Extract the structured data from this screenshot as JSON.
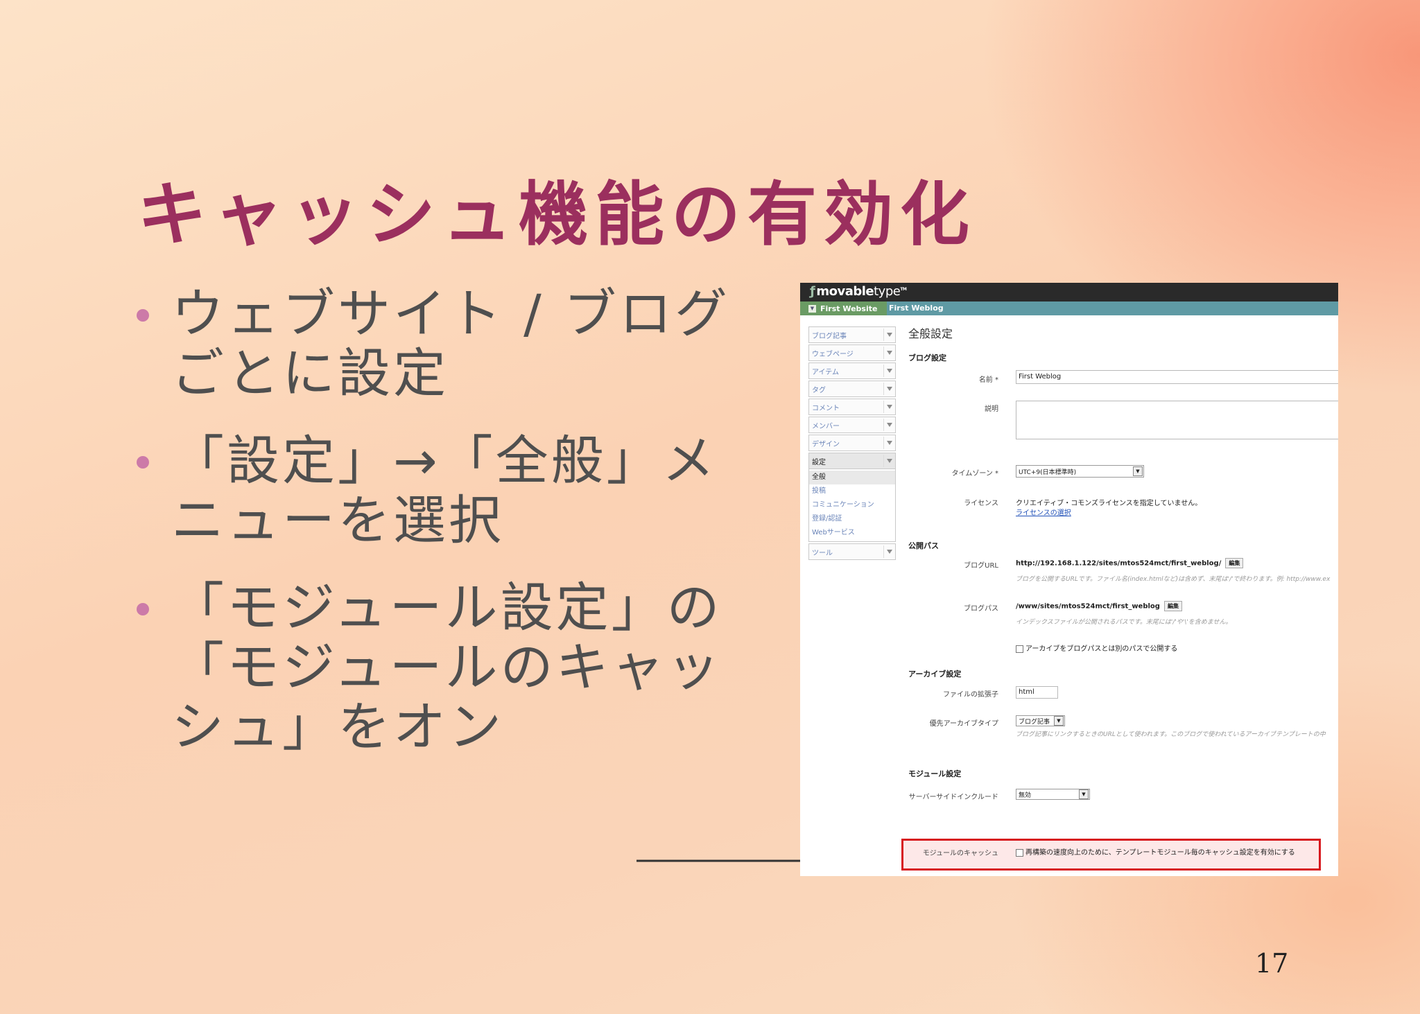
{
  "slide": {
    "title": "キャッシュ機能の有効化",
    "bullets": [
      "ウェブサイト / ブログごとに設定",
      "「設定」→「全般」メニューを選択",
      "「モジュール設定」の「モジュールのキャッシュ」をオン"
    ],
    "page_number": "17"
  },
  "screenshot": {
    "logo": {
      "bold": "movable",
      "light": "type",
      "tm": "TM"
    },
    "breadcrumb": {
      "website": "First Website",
      "blog": "First Weblog"
    },
    "sidebar": [
      {
        "label": "ブログ記事"
      },
      {
        "label": "ウェブページ"
      },
      {
        "label": "アイテム"
      },
      {
        "label": "タグ"
      },
      {
        "label": "コメント"
      },
      {
        "label": "メンバー"
      },
      {
        "label": "デザイン"
      },
      {
        "label": "設定"
      },
      {
        "label": "ツール"
      }
    ],
    "settings_subitems": [
      "全般",
      "投稿",
      "コミュニケーション",
      "登録/認証",
      "Webサービス"
    ],
    "page_heading": "全般設定",
    "blog_settings": {
      "heading": "ブログ設定",
      "name_label": "名前 *",
      "name_value": "First Weblog",
      "description_label": "説明",
      "timezone_label": "タイムゾーン *",
      "timezone_value": "UTC+9(日本標準時)",
      "license_label": "ライセンス",
      "license_text": "クリエイティブ・コモンズライセンスを指定していません。",
      "license_link": "ライセンスの選択"
    },
    "publish_paths": {
      "heading": "公開パス",
      "url_label": "ブログURL",
      "url_value": "http://192.168.1.122/sites/mtos524mct/first_weblog/",
      "edit": "編集",
      "url_hint": "ブログを公開するURLです。ファイル名(index.htmlなど)は含めず、末尾は'/'で終わります。例: http://www.ex",
      "path_label": "ブログパス",
      "path_value": "/www/sites/mtos524mct/first_weblog",
      "path_hint": "インデックスファイルが公開されるパスです。末尾には'/'や'\\'を含めません。",
      "archive_separate": "アーカイブをブログパスとは別のパスで公開する"
    },
    "archive_settings": {
      "heading": "アーカイブ設定",
      "ext_label": "ファイルの拡張子",
      "ext_value": "html",
      "pref_label": "優先アーカイブタイプ",
      "pref_value": "ブログ記事",
      "pref_hint": "ブログ記事にリンクするときのURLとして使われます。このブログで使われているアーカイブテンプレートの中"
    },
    "module_settings": {
      "heading": "モジュール設定",
      "ssi_label": "サーバーサイドインクルード",
      "ssi_value": "無効",
      "cache_label": "モジュールのキャッシュ",
      "cache_text": "再構築の速度向上のために、テンプレートモジュール毎のキャッシュ設定を有効にする"
    }
  },
  "colors": {
    "title": "#9b2f5e",
    "highlight": "#d7191f",
    "nav": "#5f9aa4"
  }
}
